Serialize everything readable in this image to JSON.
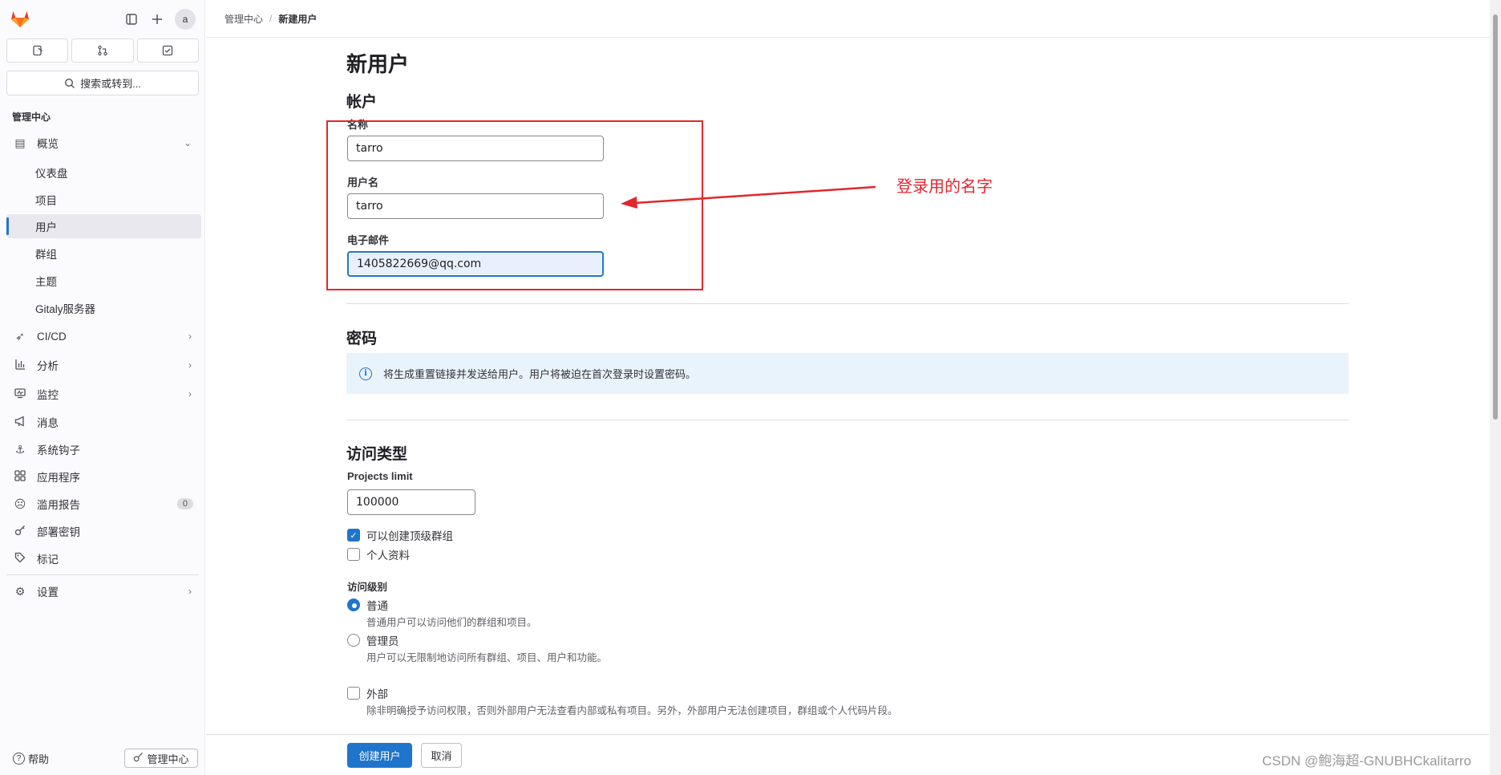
{
  "sidebar": {
    "section_title": "管理中心",
    "search_label": "搜索或转到...",
    "avatar_alt": "a",
    "items": [
      {
        "label": "概览",
        "icon": "overview-icon"
      },
      {
        "label": "仪表盘"
      },
      {
        "label": "项目"
      },
      {
        "label": "用户"
      },
      {
        "label": "群组"
      },
      {
        "label": "主题"
      },
      {
        "label": "Gitaly服务器"
      },
      {
        "label": "CI/CD",
        "icon": "rocket-icon"
      },
      {
        "label": "分析",
        "icon": "chart-icon"
      },
      {
        "label": "监控",
        "icon": "monitor-icon"
      },
      {
        "label": "消息",
        "icon": "megaphone-icon"
      },
      {
        "label": "系统钩子",
        "icon": "anchor-icon"
      },
      {
        "label": "应用程序",
        "icon": "apps-icon"
      },
      {
        "label": "滥用报告",
        "icon": "abuse-icon",
        "count": "0"
      },
      {
        "label": "部署密钥",
        "icon": "key-icon"
      },
      {
        "label": "标记",
        "icon": "label-icon"
      },
      {
        "label": "设置",
        "icon": "settings-icon"
      }
    ],
    "help_label": "帮助",
    "admin_label": "管理中心"
  },
  "breadcrumb": {
    "parent": "管理中心",
    "separator": "/",
    "current": "新建用户"
  },
  "form": {
    "title": "新用户",
    "account_section": "帐户",
    "name_label": "名称",
    "name_value": "tarro",
    "username_label": "用户名",
    "username_value": "tarro",
    "email_label": "电子邮件",
    "email_value": "1405822669@qq.com",
    "password_section": "密码",
    "password_alert": "将生成重置链接并发送给用户。用户将被迫在首次登录时设置密码。",
    "access_section": "访问类型",
    "projects_limit_label": "Projects limit",
    "projects_limit_value": "100000",
    "can_create_group_label": "可以创建顶级群组",
    "can_create_group_checked": true,
    "private_profile_label": "个人资料",
    "private_profile_checked": false,
    "access_level_label": "访问级别",
    "regular_label": "普通",
    "regular_help": "普通用户可以访问他们的群组和项目。",
    "admin_label": "管理员",
    "admin_help": "用户可以无限制地访问所有群组、项目、用户和功能。",
    "external_label": "外部",
    "external_help": "除非明确授予访问权限，否则外部用户无法查看内部或私有项目。另外，外部用户无法创建项目，群组或个人代码片段。",
    "create_button": "创建用户",
    "cancel_button": "取消"
  },
  "annotation": {
    "text": "登录用的名字",
    "color": "#e3262e"
  },
  "watermark": "CSDN @鲍海超-GNUBHCkalitarro",
  "colors": {
    "accent": "#1f75cb",
    "alert_bg": "#e9f3fc"
  }
}
